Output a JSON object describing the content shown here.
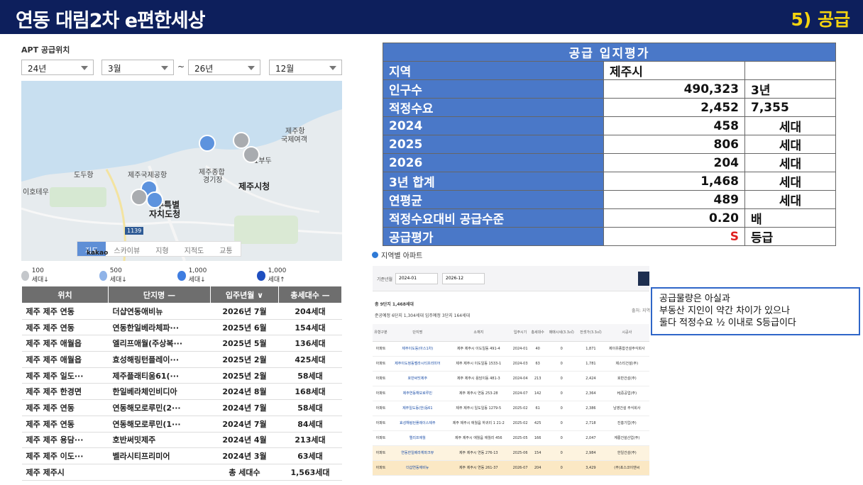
{
  "header": {
    "title": "연동 대림2차 e편한세상",
    "section": "5) 공급"
  },
  "apt_section": {
    "label": "APT 공급위치",
    "filters": [
      {
        "value": "24년"
      },
      {
        "value": "3월"
      },
      {
        "value": "26년"
      },
      {
        "value": "12월"
      }
    ],
    "range_sep": "~"
  },
  "map": {
    "labels": [
      "제주항",
      "국제여객",
      "도두항",
      "제주국제공항",
      "제주종합",
      "경기장",
      "1부두",
      "이호테우",
      "제주시청",
      "주특별",
      "자치도청"
    ],
    "road": "1139",
    "tabs": [
      "지도",
      "스카이뷰",
      "지형",
      "지적도",
      "교통"
    ],
    "active_tab": "지도",
    "brand": "kakao"
  },
  "legend": [
    "100세대↓",
    "500세대↓",
    "1,000세대↓",
    "1,000세대↑"
  ],
  "apt_table": {
    "headers": [
      "위치",
      "단지명 —",
      "입주년월 ∨",
      "총세대수 —"
    ],
    "rows": [
      [
        "제주 제주 연동",
        "더샵연동애비뉴",
        "2026년 7월",
        "204세대"
      ],
      [
        "제주 제주 연동",
        "연동한일베라체파···",
        "2025년 6월",
        "154세대"
      ],
      [
        "제주 제주 애월읍",
        "엘리프애월(주상복···",
        "2025년 5월",
        "136세대"
      ],
      [
        "제주 제주 애월읍",
        "효성해링턴플레이···",
        "2025년 2월",
        "425세대"
      ],
      [
        "제주 제주 일도···",
        "제주플래티움61(···",
        "2025년 2월",
        "58세대"
      ],
      [
        "제주 제주 한경면",
        "한일베라체인비디아",
        "2024년 8월",
        "168세대"
      ],
      [
        "제주 제주 연동",
        "연동해모로루민(2···",
        "2024년 7월",
        "58세대"
      ],
      [
        "제주 제주 연동",
        "연동해모로루민(1···",
        "2024년 7월",
        "84세대"
      ],
      [
        "제주 제주 용담···",
        "호반써밋제주",
        "2024년 4월",
        "213세대"
      ],
      [
        "제주 제주 이도···",
        "벨라시티프리미어",
        "2024년 3월",
        "63세대"
      ],
      [
        "제주 제주시",
        "",
        "총 세대수",
        "1,563세대"
      ]
    ]
  },
  "evaluation": {
    "title": "공급 입지평가",
    "rows": [
      {
        "k": "지역",
        "v": "제주시",
        "u": ""
      },
      {
        "k": "인구수",
        "v": "490,323",
        "u": "3년"
      },
      {
        "k": "적정수요",
        "v": "2,452",
        "u": "7,355"
      },
      {
        "k": "2024",
        "v": "458",
        "u": "세대"
      },
      {
        "k": "2025",
        "v": "806",
        "u": "세대"
      },
      {
        "k": "2026",
        "v": "204",
        "u": "세대"
      },
      {
        "k": "3년 합계",
        "v": "1,468",
        "u": "세대"
      },
      {
        "k": "연평균",
        "v": "489",
        "u": "세대"
      },
      {
        "k": "적정수요대비 공급수준",
        "v": "0.20",
        "u": "배"
      },
      {
        "k": "공급평가",
        "v": "S",
        "u": "등급"
      }
    ]
  },
  "regional": {
    "title": "지역별 아파트",
    "period_label": "기준년월",
    "date_from": "2024-01",
    "date_to": "2026-12",
    "count_line": "총 9단지 1,468세대",
    "sub_line": "준공예정 6단지 1,304세대   입주예정 3단지 164세대",
    "note": "출처: 지역",
    "headers": [
      "유형구분",
      "단지명",
      "소재지",
      "입주시기",
      "총세대수",
      "매매시세(3.3㎡)",
      "전셋가(3.3㎡)",
      "시공사"
    ],
    "rows": [
      [
        "아파트",
        "제주이도동(아스1차)",
        "제주 제주시 이도일동 491-4",
        "2024-01",
        "40",
        "0",
        "1,871",
        "제이유종합건설주식회사"
      ],
      [
        "아파트",
        "제주이도정동벨라시티프리미어",
        "제주 제주시 이도일동 1533-1",
        "2024-03",
        "63",
        "0",
        "1,781",
        "제스티건설(주)"
      ],
      [
        "아파트",
        "호반써밋제주",
        "제주 제주시 용담이동 481-3",
        "2024-04",
        "213",
        "0",
        "2,424",
        "호반건설(주)"
      ],
      [
        "아파트",
        "제주연동해모로루민",
        "제주 제주시 연동 253-28",
        "2024-07",
        "142",
        "0",
        "2,364",
        "HJ중공업(주)"
      ],
      [
        "아파트",
        "제주일도동(한)등61",
        "제주 제주시 일도일동 1279-5",
        "2025-02",
        "61",
        "0",
        "2,386",
        "남영건설 주식회사"
      ],
      [
        "아파트",
        "효성해링턴플레이스제주",
        "제주 제주시 애월읍 하귀리 1 21-2",
        "2025-02",
        "425",
        "0",
        "2,718",
        "진흥기업(주)"
      ],
      [
        "아파트",
        "엘리프애월",
        "제주 제주시 애월읍 애월리 456",
        "2025-05",
        "166",
        "0",
        "2,047",
        "계룡건설산업(주)"
      ],
      [
        "아파트",
        "연동한일베라체파크뷰",
        "제주 제주시 연동 276-13",
        "2025-06",
        "154",
        "0",
        "2,984",
        "한일건설(주)"
      ],
      [
        "아파트",
        "더샵연동애비뉴",
        "제주 제주시 연동 261-37",
        "2026-07",
        "204",
        "0",
        "3,429",
        "(주)포스코이앤씨"
      ]
    ]
  },
  "callout": {
    "lines": [
      "공급물량은 아실과",
      "부동산 지인이 약간 차이가 있으나",
      "둘다 적정수요 ½ 이내로 S등급이다"
    ]
  },
  "colors": {
    "header_bg": "#0d1f5c",
    "section_accent": "#f5d40f",
    "eval_blue": "#4a78c8",
    "grade_red": "#e02020",
    "callout_border": "#2f66c8"
  }
}
